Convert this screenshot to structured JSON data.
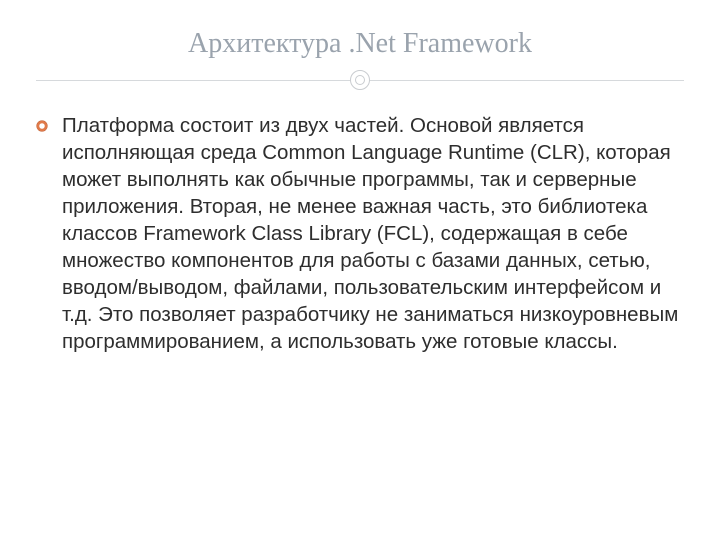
{
  "title": "Архитектура .Net Framework",
  "body_text": "Платформа состоит из двух частей. Основой является исполняющая среда Common Language Runtime (CLR), которая может выполнять как обычные программы, так и серверные приложения. Вторая, не менее важная часть, это библиотека классов Framework Class Library (FCL), содержащая в себе множество компонентов для работы с базами данных, сетью, вводом/выводом, файлами, пользовательским интерфейсом и т.д. Это позволяет разработчику не заниматься низкоуровневым программированием, а использовать уже готовые классы.",
  "colors": {
    "title": "#9aa3ad",
    "divider": "#d6d9dc",
    "bullet_fill": "#e07a4a",
    "bullet_stroke": "#b85a2f",
    "body_text": "#2e2e2e"
  }
}
